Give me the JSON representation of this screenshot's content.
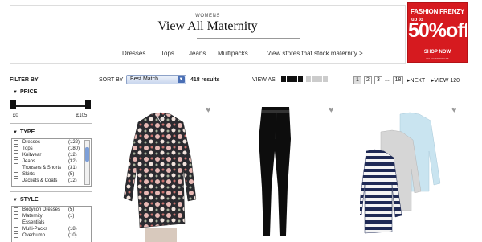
{
  "header": {
    "kicker": "WOMENS",
    "title": "View All Maternity",
    "subnav": [
      "Dresses",
      "Tops",
      "Jeans",
      "Multipacks",
      "View stores that stock maternity >"
    ]
  },
  "promo": {
    "line1": "FASHION FRENZY",
    "line2": "up to",
    "line3": "50%off",
    "line4": "SHOP NOW",
    "line5": "SELECTED STYLES"
  },
  "toolbar": {
    "filter_by": "FILTER BY",
    "sort_label": "SORT BY",
    "sort_value": "Best Match",
    "results": "418 results",
    "view_as": "VIEW AS",
    "pages": [
      "1",
      "2",
      "3",
      "...",
      "18"
    ],
    "next": "NEXT",
    "view_all": "VIEW 120"
  },
  "filters": {
    "price": {
      "title": "PRICE",
      "min": "£0",
      "max": "£105"
    },
    "type": {
      "title": "TYPE",
      "items": [
        {
          "label": "Dresses",
          "count": "(122)"
        },
        {
          "label": "Tops",
          "count": "(180)"
        },
        {
          "label": "Knitwear",
          "count": "(12)"
        },
        {
          "label": "Jeans",
          "count": "(32)"
        },
        {
          "label": "Trousers & Shorts",
          "count": "(31)"
        },
        {
          "label": "Skirts",
          "count": "(5)"
        },
        {
          "label": "Jackets & Coats",
          "count": "(12)"
        }
      ]
    },
    "style": {
      "title": "STYLE",
      "items": [
        {
          "label": "Bodycon Dresses",
          "count": "(5)"
        },
        {
          "label": "Maternity",
          "count": "(1)"
        },
        {
          "label": "Essentials",
          "count": ""
        },
        {
          "label": "Multi-Packs",
          "count": "(18)"
        },
        {
          "label": "Overbump",
          "count": "(10)"
        }
      ]
    }
  },
  "colors": {
    "promo_red": "#d61a1f",
    "select_blue": "#4a6fb5"
  }
}
